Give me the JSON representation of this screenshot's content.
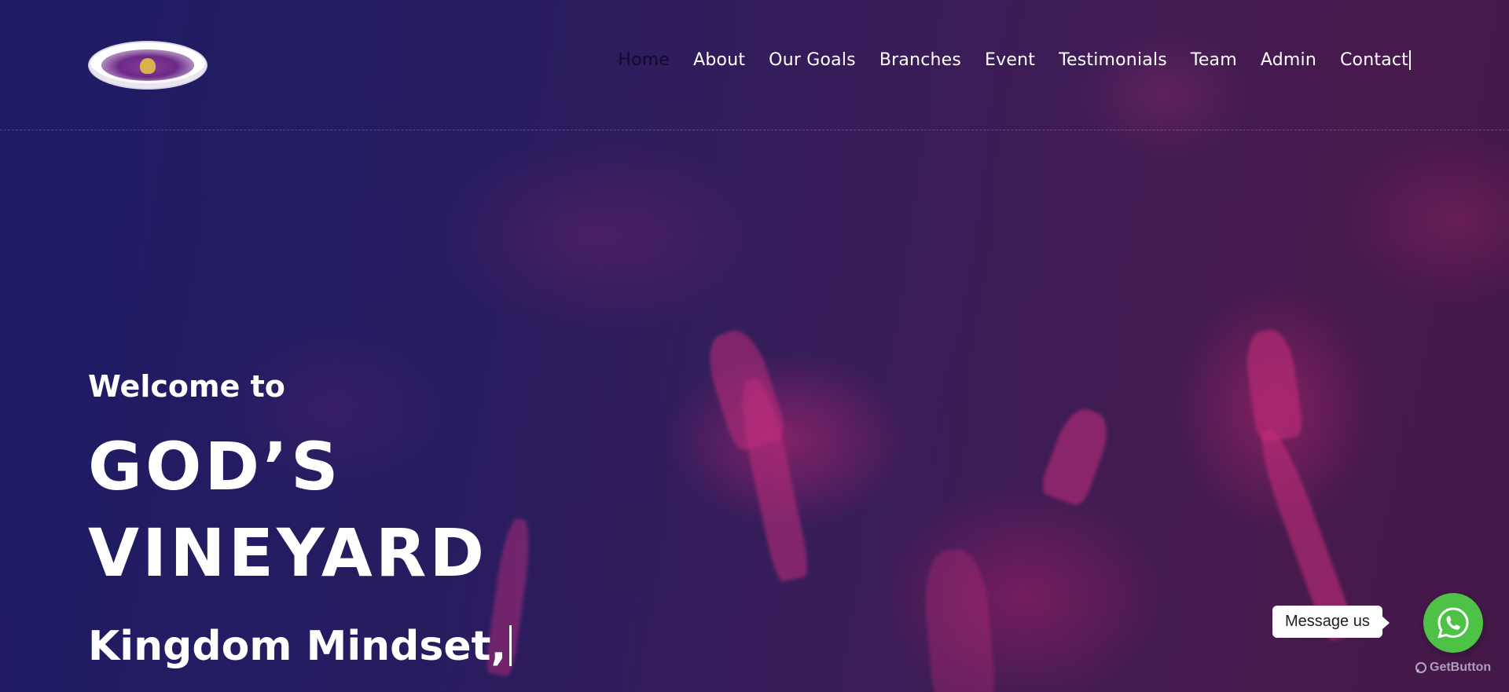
{
  "header": {
    "logo_icon": "ministry-logo-icon",
    "nav": [
      {
        "label": "Home",
        "active": true
      },
      {
        "label": "About"
      },
      {
        "label": "Our Goals"
      },
      {
        "label": "Branches"
      },
      {
        "label": "Event"
      },
      {
        "label": "Testimonials"
      },
      {
        "label": "Team"
      },
      {
        "label": "Admin"
      },
      {
        "label": "Contact"
      }
    ]
  },
  "hero": {
    "welcome": "Welcome to",
    "title_line1": "GOD’S",
    "title_line2": "VINEYARD",
    "tagline": "Kingdom Mindset,"
  },
  "whatsapp": {
    "tooltip": "Message us",
    "icon": "whatsapp-icon",
    "brand": "GetButton",
    "color": "#4dc247"
  },
  "colors": {
    "background": "#24195a",
    "accent": "#d83080",
    "text": "#ffffff",
    "active_nav": "#0e0b2e"
  }
}
